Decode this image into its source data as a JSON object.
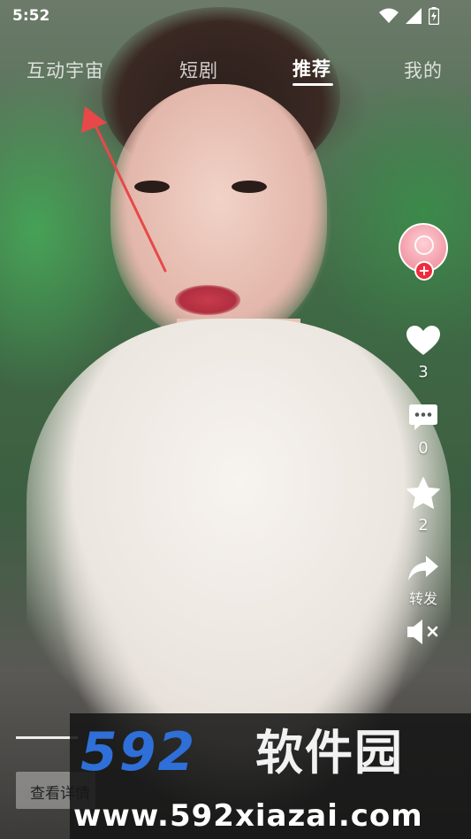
{
  "status_bar": {
    "time": "5:52",
    "icons": [
      "wifi-icon",
      "signal-icon",
      "battery-icon"
    ]
  },
  "tabs": [
    {
      "label": "互动宇宙",
      "active": false
    },
    {
      "label": "短剧",
      "active": false
    },
    {
      "label": "推荐",
      "active": true
    },
    {
      "label": "我的",
      "active": false
    }
  ],
  "actions": {
    "likes": "3",
    "comments": "0",
    "favorites": "2",
    "share_label": "转发",
    "icons": [
      "heart-icon",
      "comment-icon",
      "star-icon",
      "share-icon",
      "mute-icon"
    ]
  },
  "bottom": {
    "view_button": "查看详情"
  },
  "watermark": {
    "logo_number": "592",
    "logo_text": "软件园",
    "url": "www.592xiazai.com"
  },
  "colors": {
    "accent_red": "#f02b3c",
    "annotation_arrow": "#e84848",
    "watermark_blue": "#2f6fd8"
  }
}
